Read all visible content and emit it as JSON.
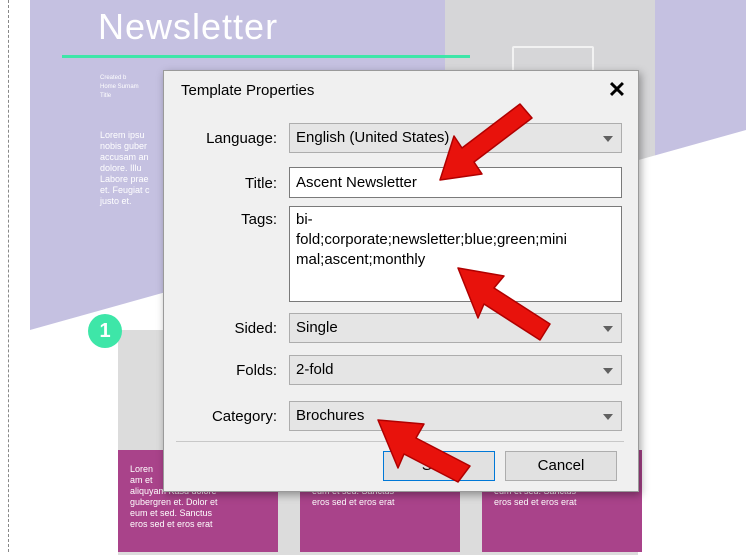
{
  "document": {
    "newsletter_title": "Newsletter",
    "meta_text": "Created b\nHome Surnam\nTitle",
    "lorem_text": "Lorem ipsu\nnobis guber\naccusam an\ndolore. Illu\nLabore prae\net. Feugiat c\njusto et.",
    "step_number": "1",
    "cards": [
      "Loren\nam et\naliquyam Kasd dolore\ngubergren et. Dolor et\neum et sed. Sanctus\neros sed et eros erat",
      "aliquyam Kasd dolore\ngubergren et. Dolor et\neum et sed. Sanctus\neros sed et eros erat",
      "aliquyam Kasd dolore\ngubergren et. Dolor et\neum et sed. Sanctus\neros sed et eros erat"
    ]
  },
  "dialog": {
    "title": "Template Properties",
    "close_glyph": "✕",
    "language_label": "Language:",
    "language_value": "English (United States)",
    "title_label": "Title:",
    "title_value": "Ascent Newsletter",
    "tags_label": "Tags:",
    "tags_value": "bi-\nfold;corporate;newsletter;blue;green;mini\nmal;ascent;monthly",
    "sided_label": "Sided:",
    "sided_value": "Single",
    "folds_label": "Folds:",
    "folds_value": "2-fold",
    "category_label": "Category:",
    "category_value": "Brochures",
    "ok_label": "Save",
    "cancel_label": "Cancel"
  },
  "colors": {
    "hero": "#c5c1e1",
    "accent_green": "#3ee6a8",
    "card_purple": "#a9438a",
    "annotation_red": "#e8120c"
  },
  "icons": [
    "photo-placeholder-icon",
    "close-icon",
    "dropdown-arrow-icon",
    "annotation-arrow"
  ]
}
